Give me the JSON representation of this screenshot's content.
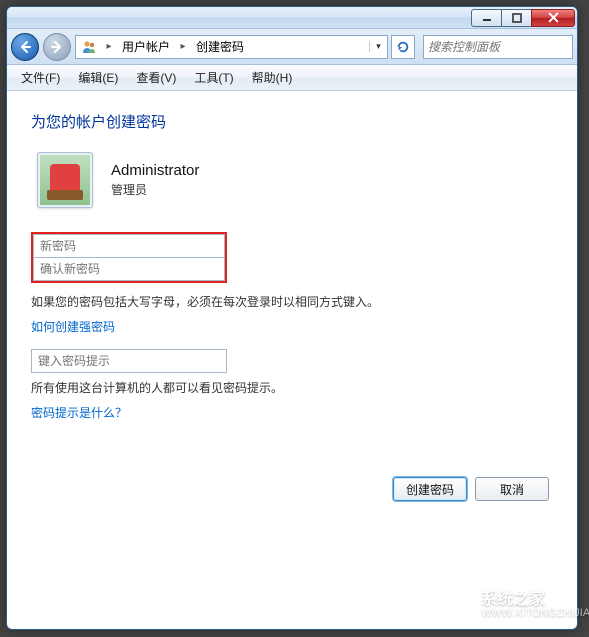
{
  "breadcrumb": {
    "segment1": "用户帐户",
    "segment2": "创建密码"
  },
  "search": {
    "placeholder": "搜索控制面板"
  },
  "menu": {
    "file": "文件(F)",
    "edit": "编辑(E)",
    "view": "查看(V)",
    "tools": "工具(T)",
    "help": "帮助(H)"
  },
  "heading": "为您的帐户创建密码",
  "user": {
    "name": "Administrator",
    "role": "管理员"
  },
  "inputs": {
    "new_password_placeholder": "新密码",
    "confirm_password_placeholder": "确认新密码",
    "hint_placeholder": "键入密码提示"
  },
  "text": {
    "caps_warning": "如果您的密码包括大写字母，必须在每次登录时以相同方式键入。",
    "strong_pw_link": "如何创建强密码",
    "hint_warning": "所有使用这台计算机的人都可以看见密码提示。",
    "hint_whatis_link": "密码提示是什么？"
  },
  "buttons": {
    "create": "创建密码",
    "cancel": "取消"
  },
  "watermark": {
    "name": "系统之家",
    "url": "WWW.XITONGZHIJIA.NET"
  }
}
